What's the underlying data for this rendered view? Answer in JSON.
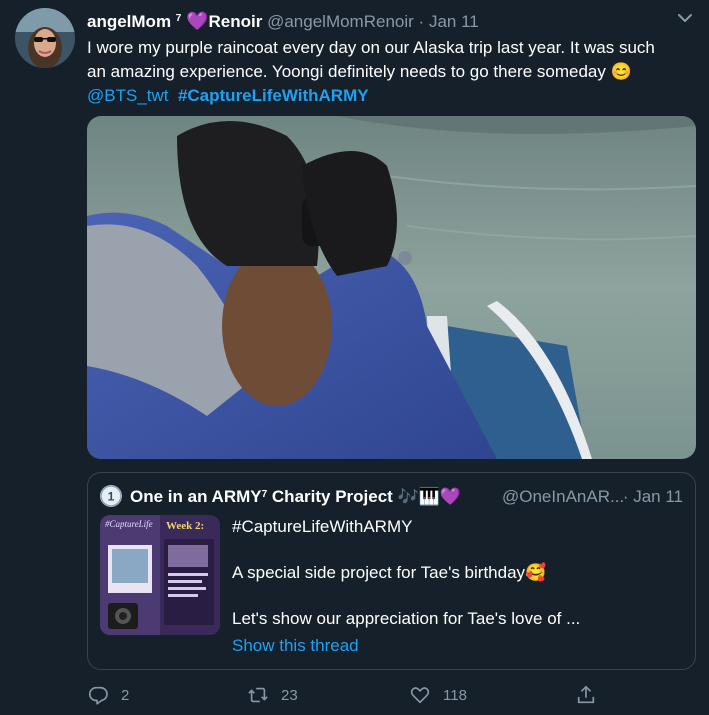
{
  "tweet": {
    "author_name": "angelMom",
    "author_sup": "7",
    "author_name_suffix": "Renoir",
    "handle": "@angelMomRenoir",
    "separator": "·",
    "date": "Jan 11",
    "text_line1": "I wore my purple raincoat every day on our Alaska trip last year. It was such",
    "text_line2": "an amazing experience. Yoongi definitely needs to go there someday 😊",
    "mention": "@BTS_twt",
    "hashtag": "#CaptureLifeWithARMY"
  },
  "quote": {
    "author_name": "One in an ARMY",
    "author_sup": "7",
    "author_name_suffix": "Charity Project 🎶🎹💜",
    "handle": "@OneInAnAR...",
    "separator": "·",
    "date": "Jan 11",
    "text_p1": "#CaptureLifeWithARMY",
    "text_p2": "A special side project for Tae's birthday🥰",
    "text_p3": "Let's show our appreciation for Tae's love of ...",
    "show_thread": "Show this thread",
    "thumb_title": "#CaptureLife",
    "thumb_subtitle": "Week 2:"
  },
  "actions": {
    "reply_count": "2",
    "retweet_count": "23",
    "like_count": "118"
  },
  "colors": {
    "background": "#15202b",
    "accent": "#1da1f2",
    "secondary_text": "#8899a6",
    "border": "#38444d"
  },
  "icons": [
    "caret-down-icon",
    "purple-heart-icon",
    "reply-icon",
    "retweet-icon",
    "like-icon",
    "share-icon"
  ]
}
